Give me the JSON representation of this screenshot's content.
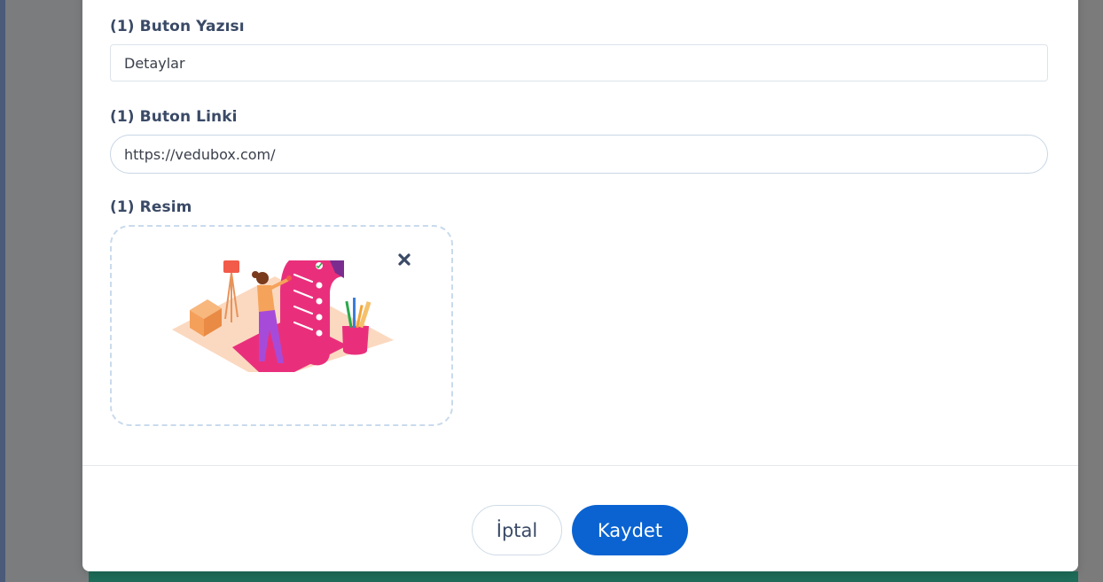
{
  "form": {
    "button_text": {
      "label": "(1) Buton Yazısı",
      "value": "Detaylar"
    },
    "button_link": {
      "label": "(1) Buton Linki",
      "value": "https://vedubox.com/"
    },
    "image": {
      "label": "(1) Resim",
      "remove_icon": "close-icon"
    }
  },
  "footer": {
    "cancel_label": "İptal",
    "save_label": "Kaydet"
  },
  "colors": {
    "primary": "#0a63d1",
    "label_text": "#3a4a66",
    "input_border": "#dde3ea",
    "dashed_border": "#c9daec"
  }
}
